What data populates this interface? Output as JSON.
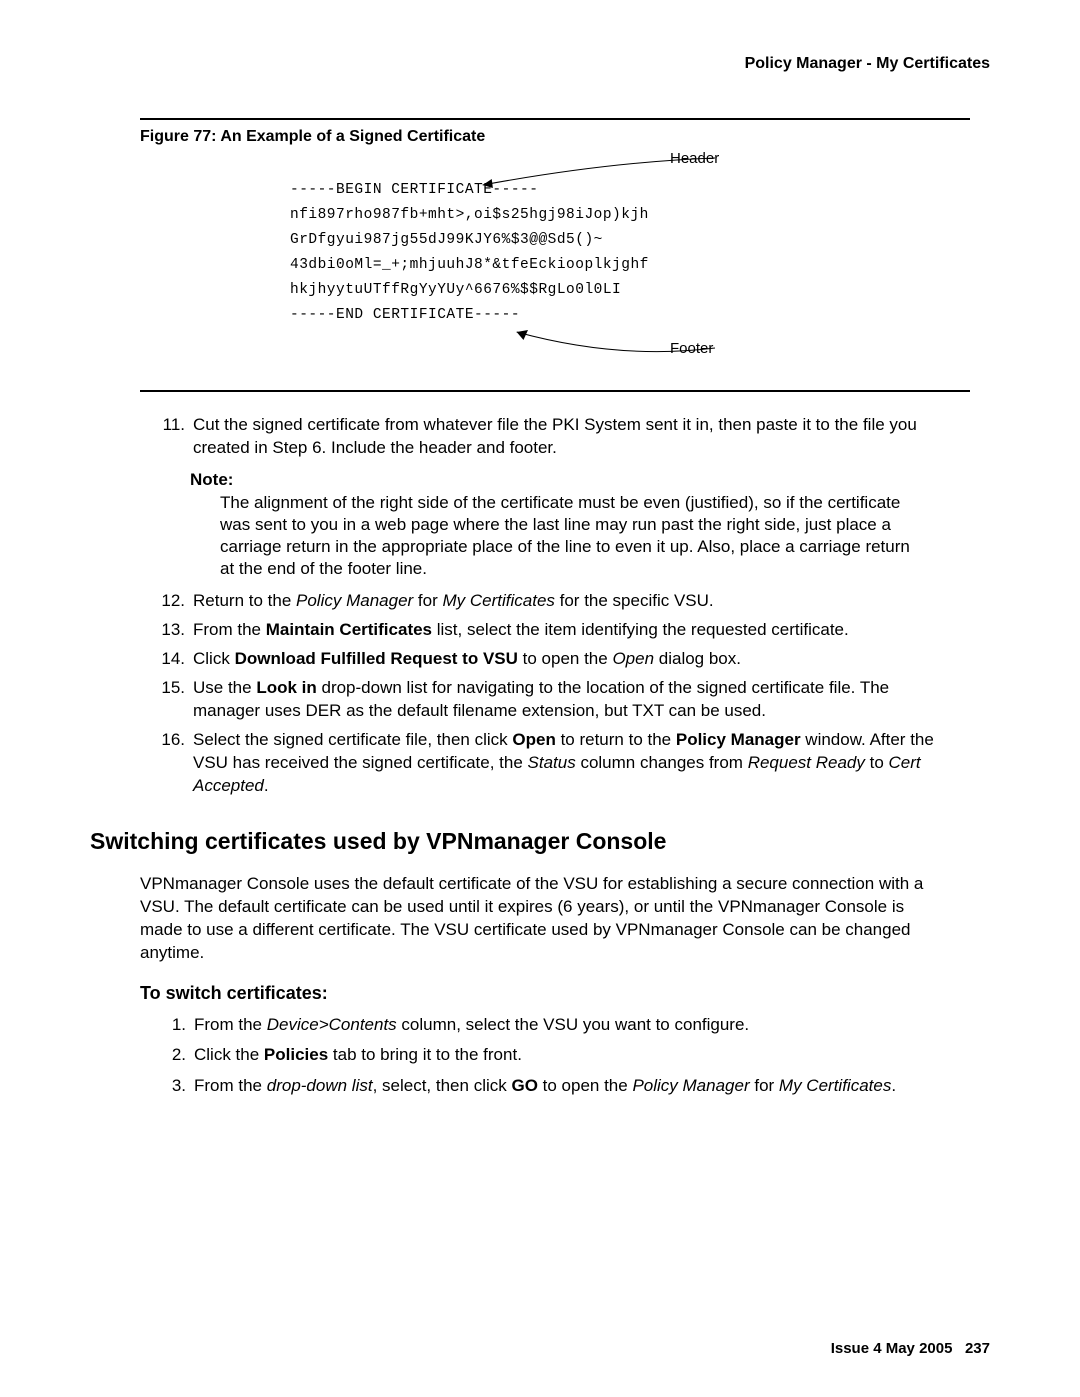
{
  "header": {
    "running_title": "Policy Manager - My Certificates"
  },
  "figure": {
    "caption": "Figure 77: An Example of a Signed Certificate",
    "label_header": "Header",
    "label_footer": "Footer",
    "cert_lines": [
      "-----BEGIN CERTIFICATE-----",
      "nfi897rho987fb+mht>,oi$s25hgj98iJop)kjh",
      "GrDfgyui987jg55dJ99KJY6%$3@@Sd5()~",
      "43dbi0oMl=_+;mhjuuhJ8*&tfeEckiooplkjghf",
      "hkjhyytuUTffRgYyYUy^6676%$$RgLo0l0LI",
      "-----END CERTIFICATE-----"
    ]
  },
  "steps": {
    "s11_num": "11.",
    "s11_text": "Cut the signed certificate from whatever file the PKI System sent it in, then paste it to the file you created in Step 6. Include the header and footer.",
    "note_label": "Note:",
    "note_text": "The alignment of the right side of the certificate must be even (justified), so if the certificate was sent to you in a web page where the last line may run past the right side, just place a carriage return in the appropriate place of the line to even it up. Also, place a carriage return at the end of the footer line.",
    "s12_num": "12.",
    "s12_a": "Return to the ",
    "s12_i1": "Policy Manager",
    "s12_b": " for ",
    "s12_i2": "My Certificates",
    "s12_c": " for the specific VSU.",
    "s13_num": "13.",
    "s13_a": "From the ",
    "s13_b1": "Maintain Certificates",
    "s13_c": " list, select the item identifying the requested certificate.",
    "s14_num": "14.",
    "s14_a": "Click ",
    "s14_b1": "Download Fulfilled Request to VSU",
    "s14_b": " to open the ",
    "s14_i1": "Open",
    "s14_c": " dialog box.",
    "s15_num": "15.",
    "s15_a": "Use the ",
    "s15_b1": "Look in",
    "s15_c": " drop-down list for navigating to the location of the signed certificate file. The manager uses DER as the default filename extension, but TXT can be used.",
    "s16_num": "16.",
    "s16_a": "Select the signed certificate file, then click ",
    "s16_b1": "Open",
    "s16_b": " to return to the ",
    "s16_b2": "Policy Manager",
    "s16_c": " window. After the VSU has received the signed certificate, the ",
    "s16_i1": "Status",
    "s16_d": " column changes from ",
    "s16_i2": "Request Ready",
    "s16_e": " to ",
    "s16_i3": "Cert Accepted",
    "s16_f": "."
  },
  "section2": {
    "title": "Switching certificates used by VPNmanager Console",
    "para": "VPNmanager Console uses the default certificate of the VSU for establishing a secure connection with a VSU. The default certificate can be used until it expires (6 years), or until the VPNmanager Console is made to use a different certificate. The VSU certificate used by VPNmanager Console can be changed anytime.",
    "subheading": "To switch certificates:",
    "s1_num": "1.",
    "s1_a": "From the ",
    "s1_i1": "Device>Contents",
    "s1_b": " column, select the VSU you want to configure.",
    "s2_num": "2.",
    "s2_a": "Click the ",
    "s2_b1": "Policies",
    "s2_b": " tab to bring it to the front.",
    "s3_num": "3.",
    "s3_a": "From the ",
    "s3_i1": "drop-down list",
    "s3_b": ", select, then click ",
    "s3_b1": "GO",
    "s3_c": " to open the ",
    "s3_i2": "Policy Manager",
    "s3_d": " for ",
    "s3_i3": "My Certificates",
    "s3_e": "."
  },
  "footer": {
    "issue": "Issue 4   May 2005",
    "page": "237"
  }
}
